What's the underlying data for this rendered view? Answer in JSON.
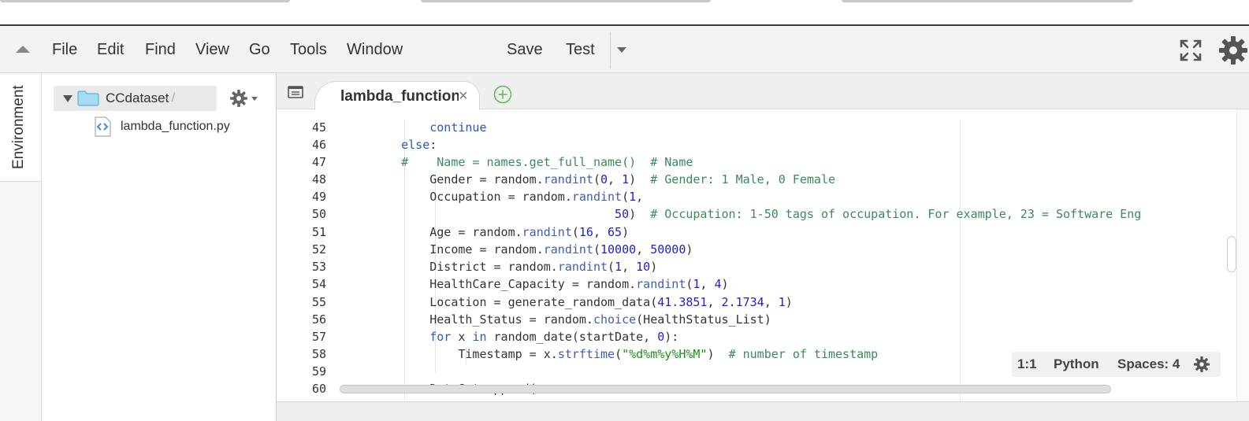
{
  "menubar": {
    "items": [
      "File",
      "Edit",
      "Find",
      "View",
      "Go",
      "Tools",
      "Window",
      "Save",
      "Test"
    ]
  },
  "sidebar": {
    "environment_label": "Environment",
    "root_folder": "CCdataset",
    "root_suffix": "- /",
    "file": "lambda_function.py"
  },
  "editor": {
    "tab_label": "lambda_function",
    "tab_close": "×",
    "line_numbers": [
      "45",
      "46",
      "47",
      "48",
      "49",
      "50",
      "51",
      "52",
      "53",
      "54",
      "55",
      "56",
      "57",
      "58",
      "59",
      "60"
    ]
  },
  "statusbar": {
    "cursor": "1:1",
    "language": "Python",
    "indent": "Spaces: 4"
  },
  "colors": {
    "keyword": "#2a5ab5",
    "number": "#2121c9",
    "comment": "#3a8a58",
    "string": "#1a8f1a",
    "folder": "#7fc4ea",
    "add_tab": "#5cb85c"
  }
}
